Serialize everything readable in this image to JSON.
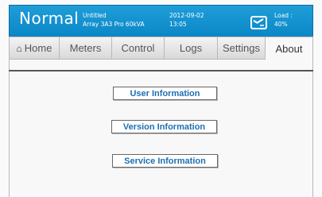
{
  "header": {
    "mode": "Normal",
    "project_name": "Untitled",
    "project_config": "Array 3A3 Pro 60kVA",
    "date": "2012-09-02",
    "time": "13:05",
    "load_label": "Load :",
    "load_value": "40%",
    "load_icon": "gauge-icon",
    "colors": {
      "bar": "#0b86c6",
      "text": "#ffffff"
    }
  },
  "tabs": [
    {
      "label": "Home",
      "icon": "home-icon"
    },
    {
      "label": "Meters"
    },
    {
      "label": "Control"
    },
    {
      "label": "Logs"
    },
    {
      "label": "Settings"
    },
    {
      "label": "About",
      "active": true
    }
  ],
  "about": {
    "buttons": {
      "user": "User Information",
      "version": "Version Information",
      "service": "Service Information"
    },
    "button_text_color": "#1d6fb3"
  }
}
